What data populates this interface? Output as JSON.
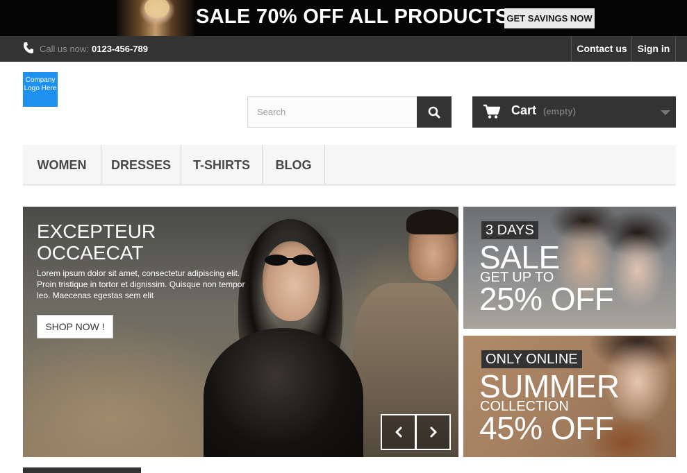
{
  "promo": {
    "title": "SALE 70% OFF ALL PRODUCTS",
    "button_label": "GET SAVINGS NOW"
  },
  "topnav": {
    "phone_icon": "phone-icon",
    "call_label": "Call us now:",
    "phone_number": "0123-456-789",
    "contact_label": "Contact us",
    "signin_label": "Sign in"
  },
  "header": {
    "logo_text": "Company Logo Here",
    "logo_color": "#1e90f0",
    "search_placeholder": "Search",
    "search_value": "",
    "search_icon": "search-icon",
    "cart_icon": "cart-icon",
    "cart_label": "Cart",
    "cart_state": "(empty)"
  },
  "menu": {
    "items": [
      {
        "label": "WOMEN"
      },
      {
        "label": "DRESSES"
      },
      {
        "label": "T-SHIRTS"
      },
      {
        "label": "BLOG"
      }
    ]
  },
  "hero": {
    "title_line1": "EXCEPTEUR",
    "title_line2": "OCCAECAT",
    "text": "Lorem ipsum dolor sit amet, consectetur adipiscing elit. Proin tristique in tortor et dignissim. Quisque non tempor leo. Maecenas egestas sem elit",
    "button_label": "SHOP NOW !",
    "prev_icon": "chevron-left-icon",
    "next_icon": "chevron-right-icon"
  },
  "banners": [
    {
      "tag": "3 DAYS",
      "headline": "SALE",
      "subline": "GET UP TO",
      "offer": "25% OFF"
    },
    {
      "tag": "ONLY ONLINE",
      "headline": "SUMMER",
      "subline": "COLLECTION",
      "offer": "45% OFF"
    }
  ],
  "colors": {
    "dark": "#333333",
    "accent_blue": "#1e90f0",
    "menu_bg": "#f6f6f6"
  }
}
